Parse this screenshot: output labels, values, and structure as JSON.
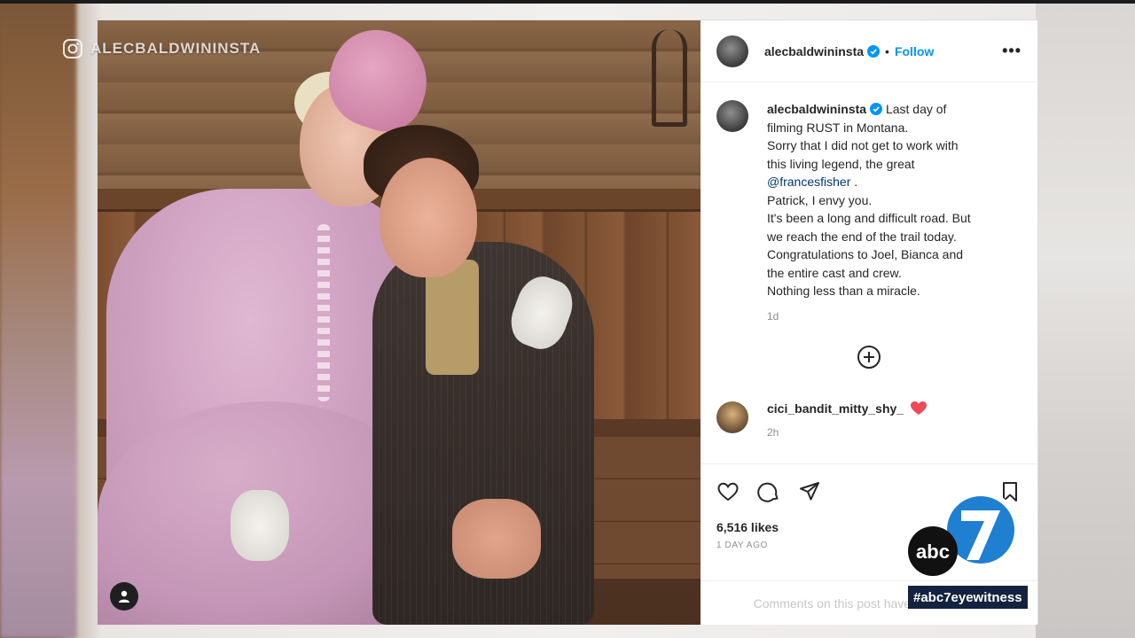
{
  "watermark": {
    "handle": "ALECBALDWININSTA"
  },
  "post": {
    "username": "alecbaldwininsta",
    "follow_label": "Follow",
    "more_label": "•••",
    "separator": "•",
    "caption_lines": [
      "Last day of",
      "filming RUST in Montana.",
      "Sorry that I did not get to work with",
      "this living legend, the great",
      "@francesfisher",
      "Patrick, I envy you.",
      "It's been a long and difficult road. But",
      "we reach the end of the trail today.",
      "Congratulations to Joel, Bianca and",
      "the entire cast and crew.",
      "Nothing less than a miracle."
    ],
    "caption_mention_suffix": ".",
    "caption_time": "1d",
    "comment": {
      "username": "cici_bandit_mitty_shy_",
      "time": "2h"
    },
    "likes": "6,516 likes",
    "date": "1 DAY AGO",
    "comments_notice": "Comments on this post have been limited."
  },
  "broadcast": {
    "hashtag": "#abc7eyewitness",
    "logo_text": "abc",
    "logo_number": "7"
  },
  "colors": {
    "follow_blue": "#0095f6",
    "mention_blue": "#00376b",
    "verified_blue": "#0095f6",
    "heart_red": "#ed4956",
    "abc_navy": "#13233f"
  }
}
